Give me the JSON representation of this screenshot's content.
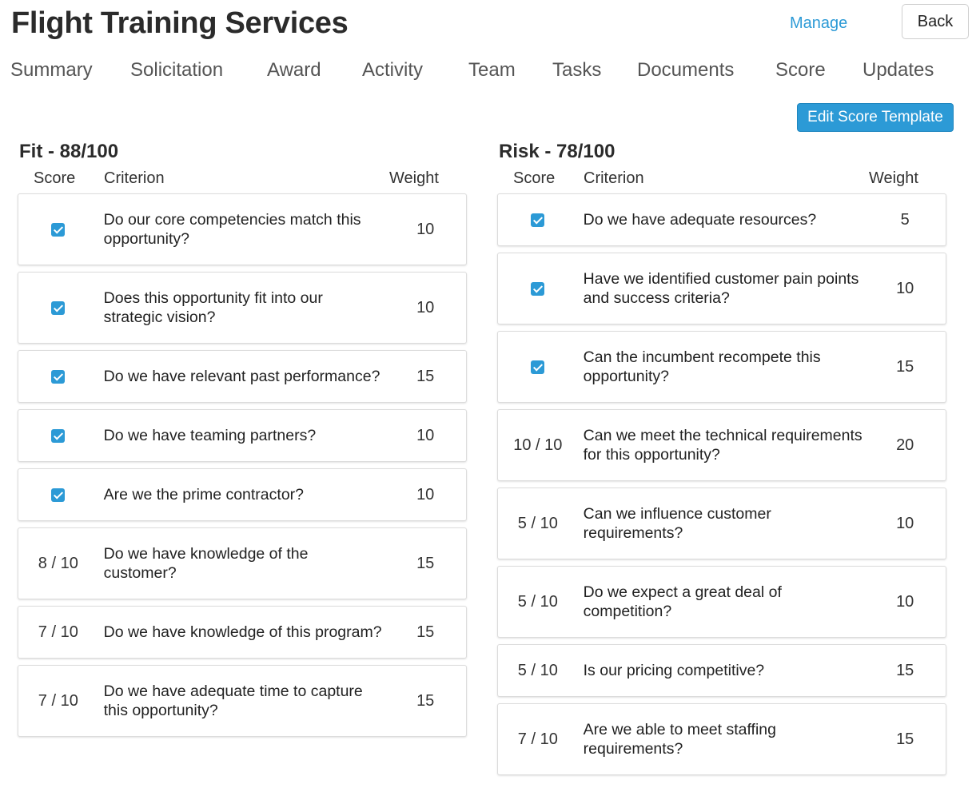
{
  "header": {
    "title": "Flight Training Services",
    "manage_label": "Manage",
    "back_label": "Back"
  },
  "tabs": [
    {
      "label": "Summary",
      "active": false
    },
    {
      "label": "Solicitation",
      "active": false
    },
    {
      "label": "Award",
      "active": false
    },
    {
      "label": "Activity",
      "active": false
    },
    {
      "label": "Team",
      "active": false
    },
    {
      "label": "Tasks",
      "active": false
    },
    {
      "label": "Documents",
      "active": false
    },
    {
      "label": "Score",
      "active": true
    },
    {
      "label": "Updates",
      "active": false
    }
  ],
  "edit_template_label": "Edit Score Template",
  "colors": {
    "accent": "#2c9ad6"
  },
  "columns": {
    "score": "Score",
    "criterion": "Criterion",
    "weight": "Weight"
  },
  "fit": {
    "title": "Fit - 88/100",
    "rows": [
      {
        "score": "",
        "checked": true,
        "criterion": "Do our core competencies match this opportunity?",
        "weight": "10"
      },
      {
        "score": "",
        "checked": true,
        "criterion": "Does this opportunity fit into our strategic vision?",
        "weight": "10"
      },
      {
        "score": "",
        "checked": true,
        "criterion": "Do we have relevant past performance?",
        "weight": "15"
      },
      {
        "score": "",
        "checked": true,
        "criterion": "Do we have teaming partners?",
        "weight": "10"
      },
      {
        "score": "",
        "checked": true,
        "criterion": "Are we the prime contractor?",
        "weight": "10"
      },
      {
        "score": "8 / 10",
        "checked": false,
        "criterion": "Do we have knowledge of the customer?",
        "weight": "15"
      },
      {
        "score": "7 / 10",
        "checked": false,
        "criterion": "Do we have knowledge of this program?",
        "weight": "15"
      },
      {
        "score": "7 / 10",
        "checked": false,
        "criterion": "Do we have adequate time to capture this opportunity?",
        "weight": "15"
      }
    ]
  },
  "risk": {
    "title": "Risk - 78/100",
    "rows": [
      {
        "score": "",
        "checked": true,
        "criterion": "Do we have adequate resources?",
        "weight": "5"
      },
      {
        "score": "",
        "checked": true,
        "criterion": "Have we identified customer pain points and success criteria?",
        "weight": "10"
      },
      {
        "score": "",
        "checked": true,
        "criterion": "Can the incumbent recompete this opportunity?",
        "weight": "15"
      },
      {
        "score": "10 / 10",
        "checked": false,
        "criterion": "Can we meet the technical requirements for this opportunity?",
        "weight": "20"
      },
      {
        "score": "5 / 10",
        "checked": false,
        "criterion": "Can we influence customer requirements?",
        "weight": "10"
      },
      {
        "score": "5 / 10",
        "checked": false,
        "criterion": "Do we expect a great deal of competition?",
        "weight": "10"
      },
      {
        "score": "5 / 10",
        "checked": false,
        "criterion": "Is our pricing competitive?",
        "weight": "15"
      },
      {
        "score": "7 / 10",
        "checked": false,
        "criterion": "Are we able to meet staffing requirements?",
        "weight": "15"
      }
    ]
  }
}
